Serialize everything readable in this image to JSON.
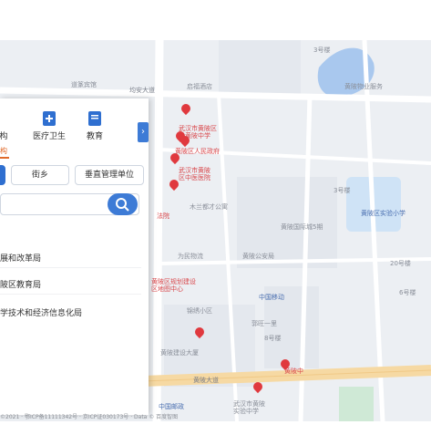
{
  "map": {
    "labels": [
      {
        "text": "道篆宾馆",
        "kind": "poi"
      },
      {
        "text": "均安大道",
        "kind": "road"
      },
      {
        "text": "启福酒店",
        "kind": "poi"
      },
      {
        "text": "武汉市黄陂区",
        "kind": "red"
      },
      {
        "text": "从黄陂中学",
        "kind": "red"
      },
      {
        "text": "黄陂区人民政府",
        "kind": "red"
      },
      {
        "text": "武汉市黄陂",
        "kind": "red"
      },
      {
        "text": "区中医医院",
        "kind": "red"
      },
      {
        "text": "法院",
        "kind": "red"
      },
      {
        "text": "木兰都才公寓",
        "kind": "poi"
      },
      {
        "text": "黄陂国际城5期",
        "kind": "poi"
      },
      {
        "text": "3号楼",
        "kind": "poi"
      },
      {
        "text": "黄陂区实验小学",
        "kind": "blue"
      },
      {
        "text": "20号楼",
        "kind": "poi"
      },
      {
        "text": "为民物流",
        "kind": "poi"
      },
      {
        "text": "黄陂公安局",
        "kind": "poi"
      },
      {
        "text": "黄陂区规划建设",
        "kind": "red"
      },
      {
        "text": "区地图中心",
        "kind": "red"
      },
      {
        "text": "中国移动",
        "kind": "blue"
      },
      {
        "text": "锦绣小区",
        "kind": "poi"
      },
      {
        "text": "黄陂建设大厦",
        "kind": "poi"
      },
      {
        "text": "郭旺一里",
        "kind": "poi"
      },
      {
        "text": "黄陂大道",
        "kind": "road"
      },
      {
        "text": "黄陂中",
        "kind": "red"
      },
      {
        "text": "中国邮政",
        "kind": "blue"
      },
      {
        "text": "武汉市黄陂",
        "kind": "poi"
      },
      {
        "text": "实验中学",
        "kind": "poi"
      },
      {
        "text": "黄陂物业服务",
        "kind": "poi"
      },
      {
        "text": "3号楼",
        "kind": "poi"
      },
      {
        "text": "6号楼",
        "kind": "poi"
      },
      {
        "text": "8号楼",
        "kind": "poi"
      }
    ],
    "attribution": "©2021 · 鄂ICP备11111342号 · 京ICP证030173号 · Data © 百度智图"
  },
  "panel": {
    "categories": [
      {
        "label": "构",
        "icon": "office-icon"
      },
      {
        "label": "医疗卫生",
        "icon": "medical-kit-icon"
      },
      {
        "label": "教育",
        "icon": "book-icon"
      }
    ],
    "active_tab": "构",
    "filters": [
      {
        "label": "",
        "active": true
      },
      {
        "label": "街乡",
        "active": false
      },
      {
        "label": "垂直管理单位",
        "active": false
      }
    ],
    "search": {
      "placeholder": ""
    },
    "results": [
      "展和改革局",
      "陂区教育局",
      "学技术和经济信息化局"
    ],
    "collapse_glyph": "›"
  },
  "colors": {
    "accent": "#2f6fd0",
    "pin": "#e0393e",
    "active_tab": "#e06a2a",
    "water": "#a9c8ee",
    "park": "#cfe9d6",
    "road_main": "#f6d9a3"
  }
}
